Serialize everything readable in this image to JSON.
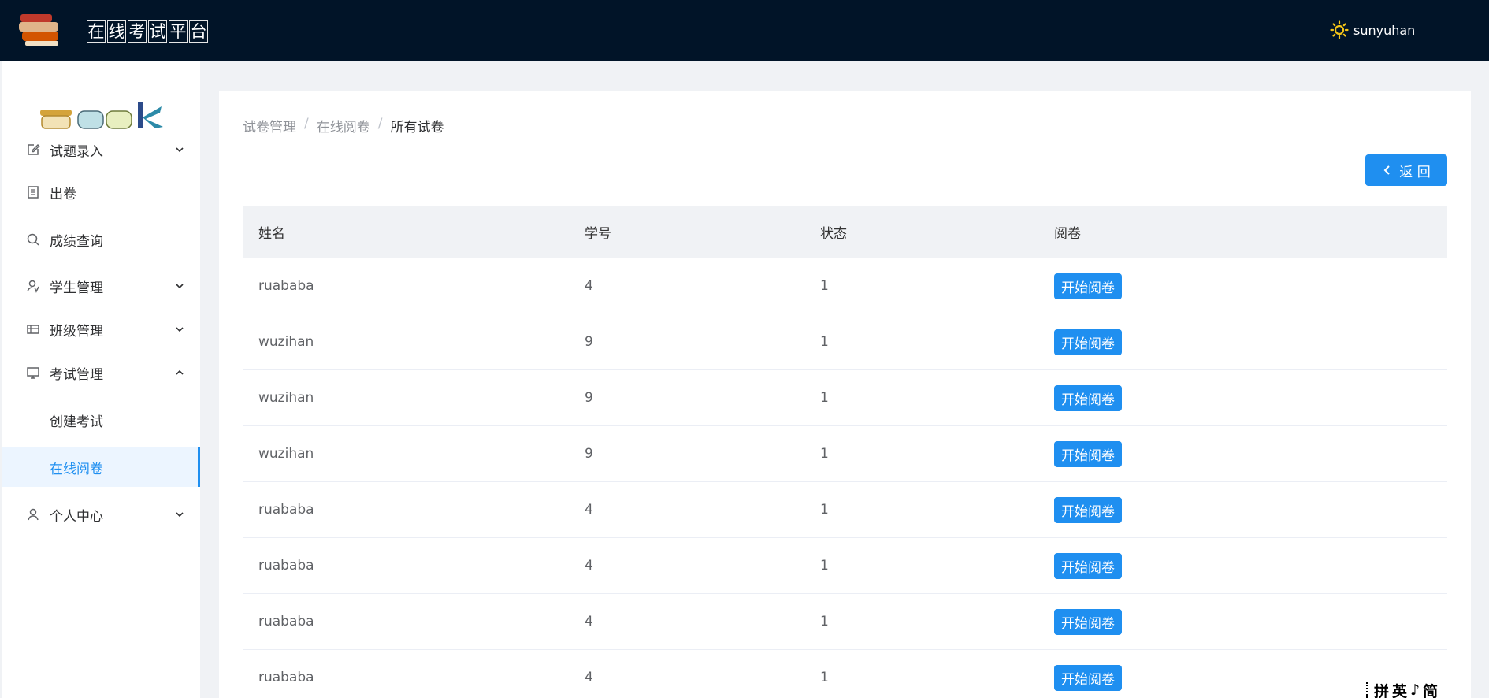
{
  "header": {
    "title_chars": [
      "在",
      "线",
      "考",
      "试",
      "平",
      "台"
    ],
    "username": "sunyuhan"
  },
  "sidebar": {
    "items": [
      {
        "label": "试题录入",
        "icon": "edit-icon",
        "expandable": true,
        "expanded": false
      },
      {
        "label": "出卷",
        "icon": "document-icon",
        "expandable": false
      },
      {
        "label": "成绩查询",
        "icon": "search-icon",
        "expandable": false
      },
      {
        "label": "学生管理",
        "icon": "student-icon",
        "expandable": true,
        "expanded": false
      },
      {
        "label": "班级管理",
        "icon": "class-icon",
        "expandable": true,
        "expanded": false
      },
      {
        "label": "考试管理",
        "icon": "monitor-icon",
        "expandable": true,
        "expanded": true
      },
      {
        "label": "创建考试",
        "sub": true
      },
      {
        "label": "在线阅卷",
        "sub": true,
        "active": true
      },
      {
        "label": "个人中心",
        "icon": "user-icon",
        "expandable": true,
        "expanded": false
      }
    ]
  },
  "breadcrumb": [
    "试卷管理",
    "在线阅卷",
    "所有试卷"
  ],
  "back_button": "返 回",
  "table": {
    "headers": [
      "姓名",
      "学号",
      "状态",
      "阅卷"
    ],
    "action_label": "开始阅卷",
    "rows": [
      {
        "name": "ruababa",
        "id": "4",
        "status": "1"
      },
      {
        "name": "wuzihan",
        "id": "9",
        "status": "1"
      },
      {
        "name": "wuzihan",
        "id": "9",
        "status": "1"
      },
      {
        "name": "wuzihan",
        "id": "9",
        "status": "1"
      },
      {
        "name": "ruababa",
        "id": "4",
        "status": "1"
      },
      {
        "name": "ruababa",
        "id": "4",
        "status": "1"
      },
      {
        "name": "ruababa",
        "id": "4",
        "status": "1"
      },
      {
        "name": "ruababa",
        "id": "4",
        "status": "1"
      }
    ]
  },
  "ime_bar": [
    "拼",
    "英",
    "♪",
    "简"
  ],
  "colors": {
    "header_bg": "#011428",
    "accent": "#1f8ff0",
    "page_bg": "#f0f2f5"
  }
}
